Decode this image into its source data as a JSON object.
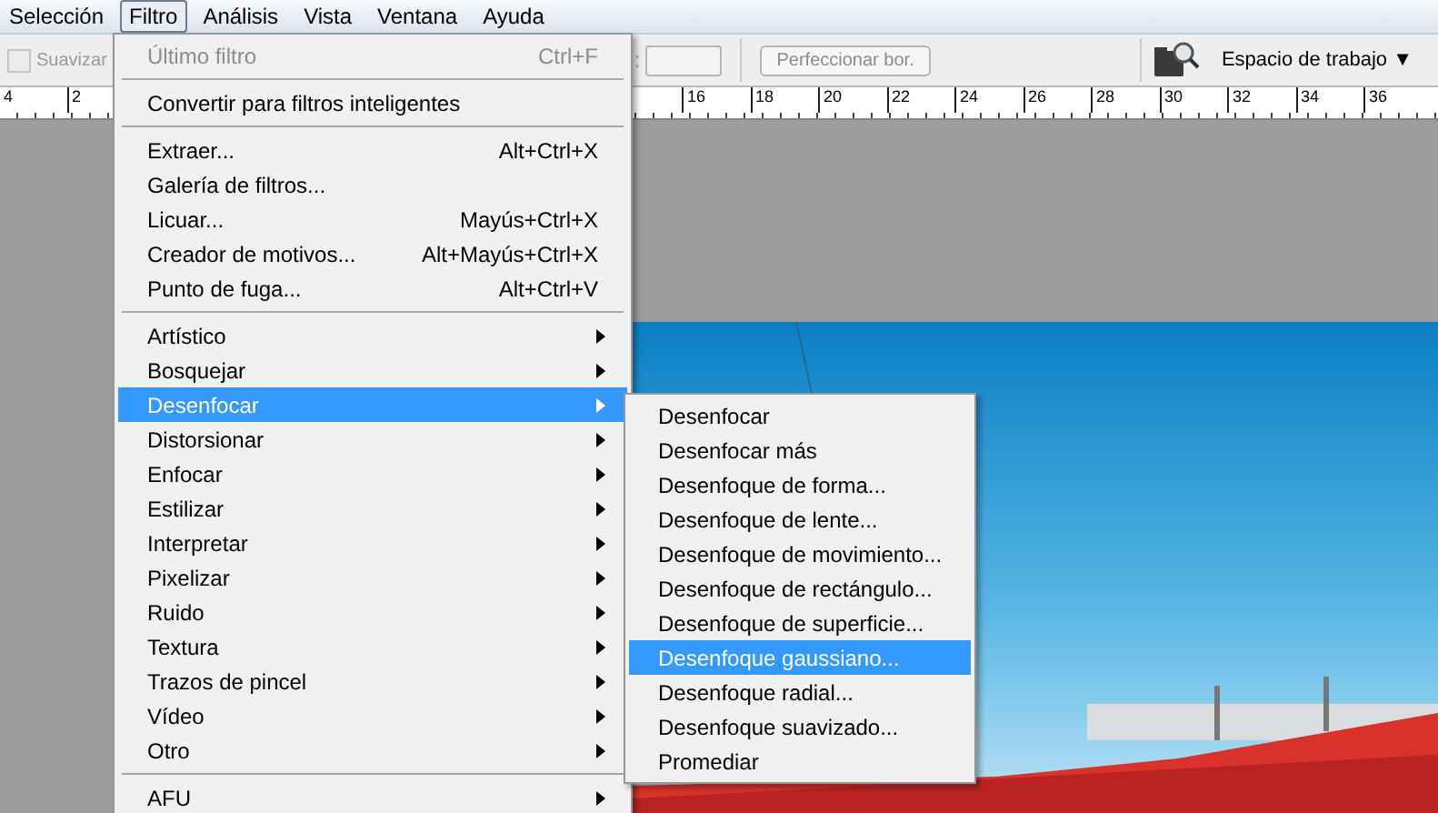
{
  "menu_bar": [
    {
      "label": "Selección",
      "selected": false
    },
    {
      "label": "Filtro",
      "selected": true
    },
    {
      "label": "Análisis",
      "selected": false
    },
    {
      "label": "Vista",
      "selected": false
    },
    {
      "label": "Ventana",
      "selected": false
    },
    {
      "label": "Ayuda",
      "selected": false
    }
  ],
  "options_bar": {
    "smooth": {
      "label": "Suavizar",
      "checked": false,
      "disabled": true
    },
    "field_label": ":",
    "refine_button": {
      "label": "Perfeccionar bor.",
      "disabled": true
    },
    "workspace": {
      "label": "Espacio de trabajo",
      "caret": "▼"
    }
  },
  "ruler": {
    "left_labels": [
      "4",
      "2"
    ],
    "right_labels": [
      "16",
      "18",
      "20",
      "22",
      "24",
      "26",
      "28",
      "30",
      "32",
      "34",
      "36"
    ]
  },
  "filter_menu": {
    "groups": [
      [
        {
          "label": "Último filtro",
          "shortcut": "Ctrl+F",
          "disabled": true,
          "submenu": false,
          "selected": false
        }
      ],
      [
        {
          "label": "Convertir para filtros inteligentes",
          "disabled": false,
          "submenu": false,
          "selected": false
        }
      ],
      [
        {
          "label": "Extraer...",
          "shortcut": "Alt+Ctrl+X",
          "disabled": false,
          "submenu": false,
          "selected": false
        },
        {
          "label": "Galería de filtros...",
          "disabled": false,
          "submenu": false,
          "selected": false
        },
        {
          "label": "Licuar...",
          "shortcut": "Mayús+Ctrl+X",
          "disabled": false,
          "submenu": false,
          "selected": false
        },
        {
          "label": "Creador de motivos...",
          "shortcut": "Alt+Mayús+Ctrl+X",
          "disabled": false,
          "submenu": false,
          "selected": false
        },
        {
          "label": "Punto de fuga...",
          "shortcut": "Alt+Ctrl+V",
          "disabled": false,
          "submenu": false,
          "selected": false
        }
      ],
      [
        {
          "label": "Artístico",
          "disabled": false,
          "submenu": true,
          "selected": false
        },
        {
          "label": "Bosquejar",
          "disabled": false,
          "submenu": true,
          "selected": false
        },
        {
          "label": "Desenfocar",
          "disabled": false,
          "submenu": true,
          "selected": true
        },
        {
          "label": "Distorsionar",
          "disabled": false,
          "submenu": true,
          "selected": false
        },
        {
          "label": "Enfocar",
          "disabled": false,
          "submenu": true,
          "selected": false
        },
        {
          "label": "Estilizar",
          "disabled": false,
          "submenu": true,
          "selected": false
        },
        {
          "label": "Interpretar",
          "disabled": false,
          "submenu": true,
          "selected": false
        },
        {
          "label": "Pixelizar",
          "disabled": false,
          "submenu": true,
          "selected": false
        },
        {
          "label": "Ruido",
          "disabled": false,
          "submenu": true,
          "selected": false
        },
        {
          "label": "Textura",
          "disabled": false,
          "submenu": true,
          "selected": false
        },
        {
          "label": "Trazos de pincel",
          "disabled": false,
          "submenu": true,
          "selected": false
        },
        {
          "label": "Vídeo",
          "disabled": false,
          "submenu": true,
          "selected": false
        },
        {
          "label": "Otro",
          "disabled": false,
          "submenu": true,
          "selected": false
        }
      ],
      [
        {
          "label": "AFU",
          "disabled": false,
          "submenu": true,
          "selected": false
        }
      ]
    ]
  },
  "blur_submenu": {
    "items": [
      {
        "label": "Desenfocar",
        "selected": false
      },
      {
        "label": "Desenfocar más",
        "selected": false
      },
      {
        "label": "Desenfoque de forma...",
        "selected": false
      },
      {
        "label": "Desenfoque de lente...",
        "selected": false
      },
      {
        "label": "Desenfoque de movimiento...",
        "selected": false
      },
      {
        "label": "Desenfoque de rectángulo...",
        "selected": false
      },
      {
        "label": "Desenfoque de superficie...",
        "selected": false
      },
      {
        "label": "Desenfoque gaussiano...",
        "selected": true
      },
      {
        "label": "Desenfoque radial...",
        "selected": false
      },
      {
        "label": "Desenfoque suavizado...",
        "selected": false
      },
      {
        "label": "Promediar",
        "selected": false
      }
    ]
  }
}
